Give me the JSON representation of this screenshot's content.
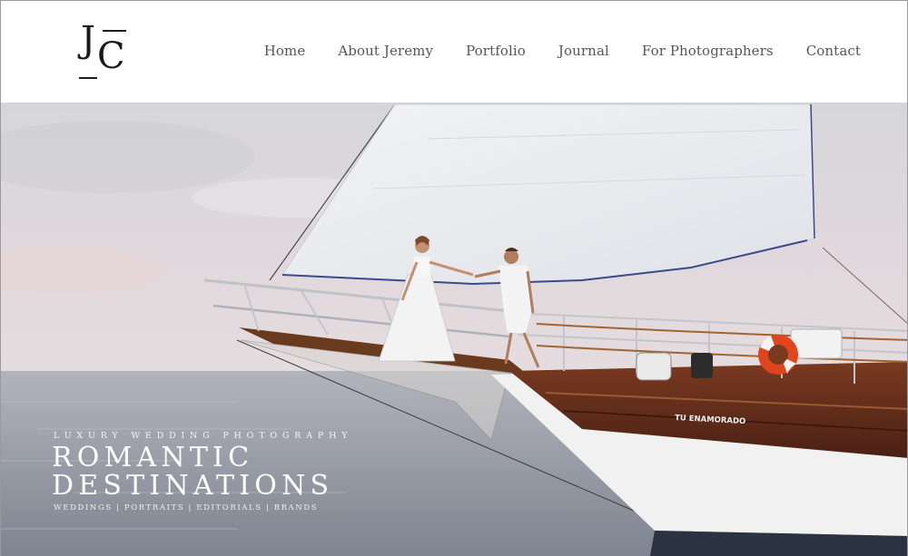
{
  "brand": {
    "logo_letters": "JC"
  },
  "nav": {
    "items": [
      {
        "label": "Home"
      },
      {
        "label": "About Jeremy"
      },
      {
        "label": "Portfolio"
      },
      {
        "label": "Journal"
      },
      {
        "label": "For Photographers"
      },
      {
        "label": "Contact"
      }
    ]
  },
  "hero": {
    "tagline": "LUXURY WEDDING PHOTOGRAPHY",
    "title_line1": "ROMANTIC",
    "title_line2": "DESTINATIONS",
    "services": "WEDDINGS | PORTRAITS | EDITORIALS | BRANDS",
    "boat_name": "TU ENAMORADO"
  },
  "colors": {
    "sky": "#d9d4d8",
    "sea": "#9aa0aa",
    "hull_wood": "#5a2a1a",
    "hull_white": "#f2f2f2",
    "sail": "#eef0f2",
    "nav_text": "#555555"
  }
}
